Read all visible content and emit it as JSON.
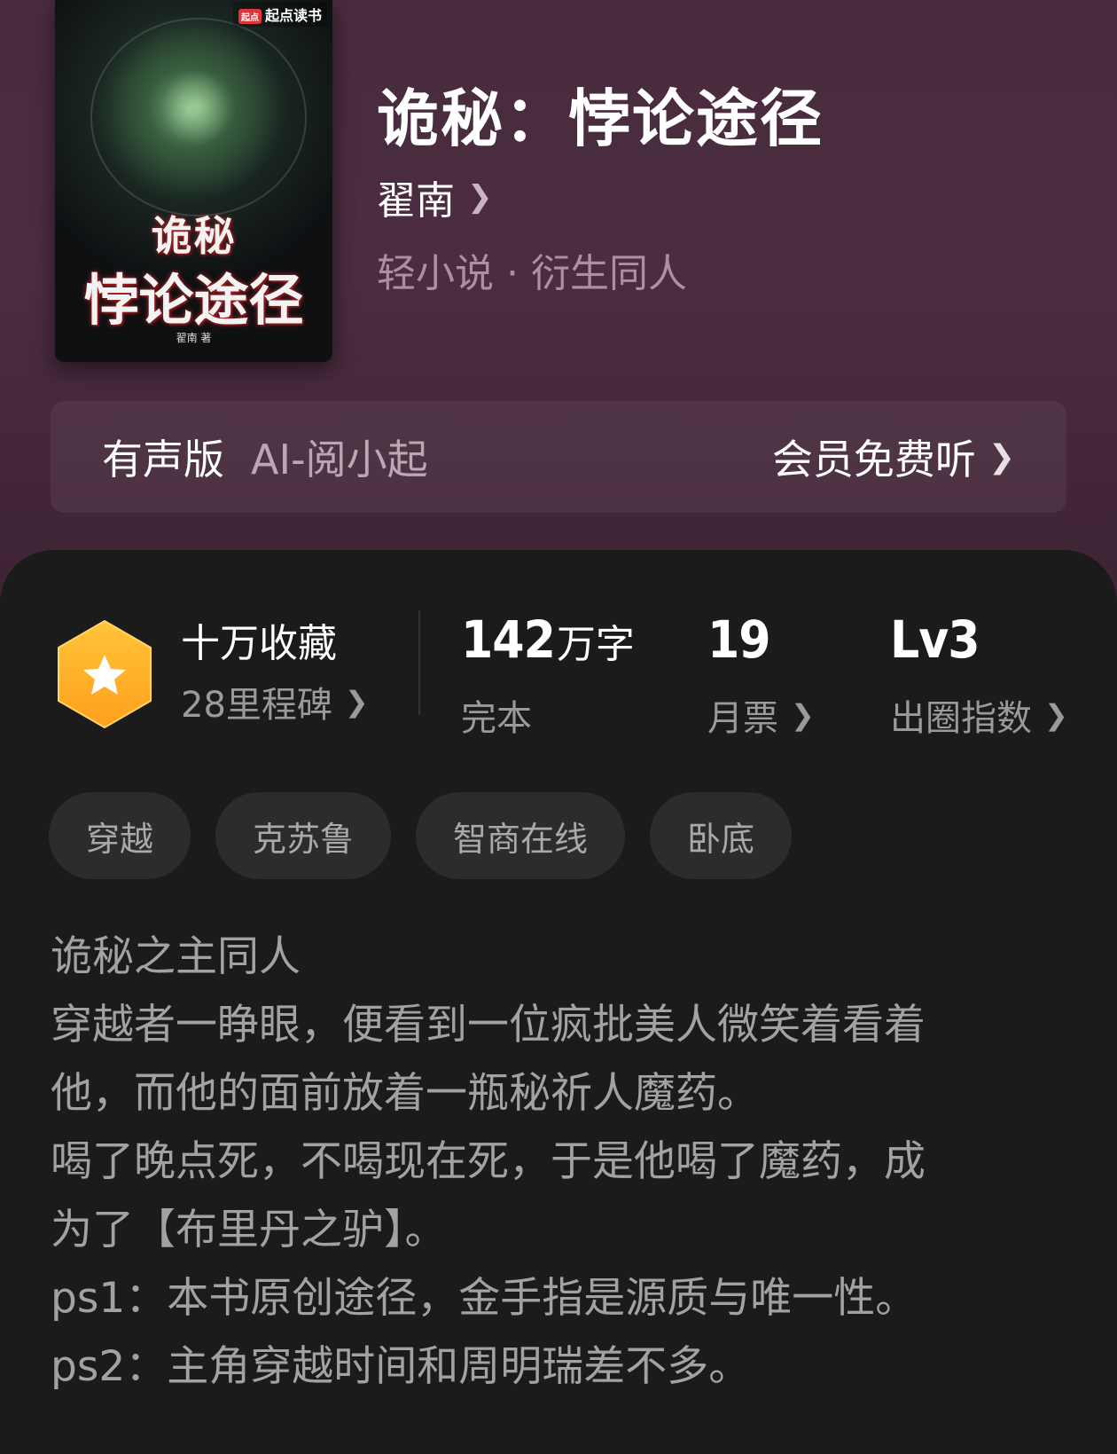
{
  "cover": {
    "brand": "起点读书",
    "brand_logo": "起点",
    "title_line1": "诡秘",
    "title_line2": "悖论途径",
    "author": "翟南 著"
  },
  "book": {
    "title": "诡秘：悖论途径",
    "author": "翟南",
    "genre": "轻小说 · 衍生同人"
  },
  "audio": {
    "label": "有声版",
    "voice": "AI-阅小起",
    "cta": "会员免费听"
  },
  "stats": {
    "collection": "十万收藏",
    "milestone": "28里程碑",
    "words_number": "142",
    "words_unit": "万字",
    "status": "完本",
    "monthly_votes": "19",
    "monthly_votes_label": "月票",
    "level": "Lv3",
    "level_label": "出圈指数"
  },
  "tags": [
    "穿越",
    "克苏鲁",
    "智商在线",
    "卧底"
  ],
  "description": [
    "诡秘之主同人",
    "穿越者一睁眼，便看到一位疯批美人微笑着看着",
    "他，而他的面前放着一瓶秘祈人魔药。",
    "喝了晚点死，不喝现在死，于是他喝了魔药，成",
    "为了【布里丹之驴】。",
    "ps1：本书原创途径，金手指是源质与唯一性。",
    "ps2：主角穿越时间和周明瑞差不多。"
  ],
  "colors": {
    "hero_bg": "#4a2b3e",
    "panel_bg": "#1b1b1c",
    "badge": "#ffb32a"
  }
}
